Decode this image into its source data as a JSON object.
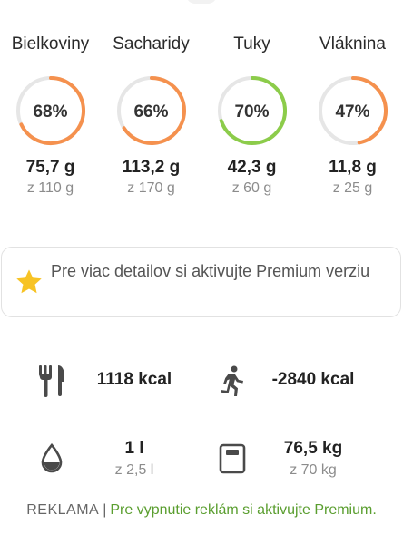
{
  "macros": [
    {
      "name": "Bielkoviny",
      "percent_label": "68%",
      "fraction": 0.68,
      "value": "75,7 g",
      "goal": "z 110 g",
      "color": "#f5914e"
    },
    {
      "name": "Sacharidy",
      "percent_label": "66%",
      "fraction": 0.66,
      "value": "113,2 g",
      "goal": "z 170 g",
      "color": "#f5914e"
    },
    {
      "name": "Tuky",
      "percent_label": "70%",
      "fraction": 0.7,
      "value": "42,3 g",
      "goal": "z 60 g",
      "color": "#8ccc4a"
    },
    {
      "name": "Vláknina",
      "percent_label": "47%",
      "fraction": 0.47,
      "value": "11,8 g",
      "goal": "z 25 g",
      "color": "#f5914e"
    }
  ],
  "premium": {
    "text": "Pre viac detailov si aktivujte Premium verziu",
    "icon": "star-icon",
    "icon_color": "#f7c325"
  },
  "stats": {
    "food": {
      "icon": "fork-knife-icon",
      "value": "1118 kcal"
    },
    "exercise": {
      "icon": "running-icon",
      "value": "-2840 kcal"
    },
    "water": {
      "icon": "water-drop-icon",
      "value": "1 l",
      "goal": "z 2,5 l"
    },
    "weight": {
      "icon": "scale-icon",
      "value": "76,5 kg",
      "goal": "z 70 kg"
    }
  },
  "ad": {
    "label": "REKLAMA",
    "separator": "|",
    "link_text": "Pre vypnutie reklám si aktivujte Premium.",
    "link_color": "#5a9e2f"
  },
  "colors": {
    "ring_track": "#e6e6e6",
    "ring_orange": "#f5914e",
    "ring_green": "#8ccc4a",
    "icon_gray": "#4a4a4a"
  }
}
